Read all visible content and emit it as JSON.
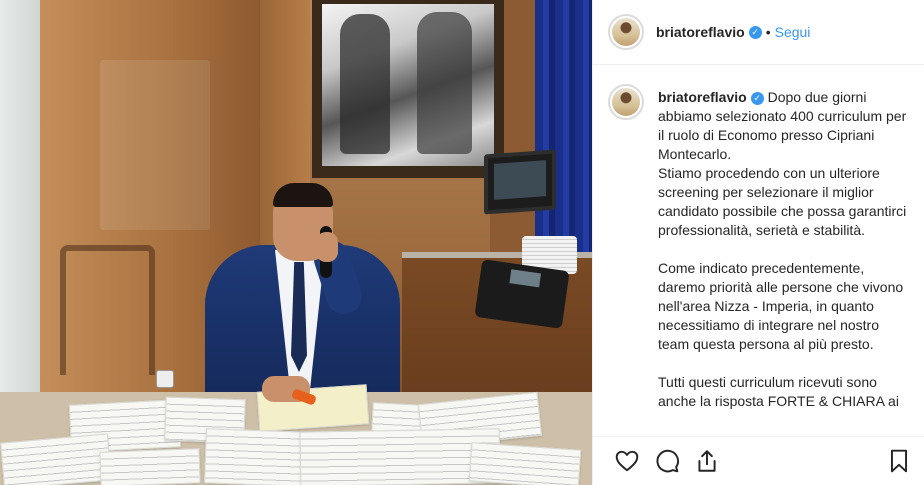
{
  "post": {
    "username": "briatoreflavio",
    "verified_icon": "verified-badge-icon",
    "separator": "•",
    "follow_label": "Segui"
  },
  "caption": {
    "username": "briatoreflavio",
    "text": " Dopo due giorni abbiamo selezionato 400 curriculum per il ruolo di Economo presso Cipriani Montecarlo.\nStiamo procedendo con un ulteriore screening per selezionare il miglior candidato possibile che possa garantirci professionalità, serietà e stabilità.\n\nCome indicato precedentemente, daremo priorità alle persone che vivono nell'area Nizza - Imperia, in quanto necessitiamo di integrare nel nostro team questa persona al più presto.\n\nTutti questi curriculum ricevuti sono anche la risposta FORTE & CHIARA ai"
  },
  "actions": {
    "like_icon": "heart-icon",
    "comment_icon": "comment-icon",
    "share_icon": "share-icon",
    "save_icon": "bookmark-icon"
  },
  "colors": {
    "link": "#3897f0",
    "text": "#262626",
    "border": "#efefef"
  }
}
